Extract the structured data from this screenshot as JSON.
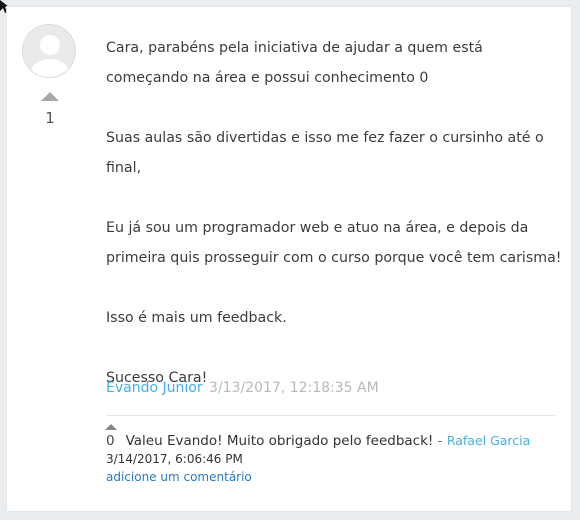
{
  "answer": {
    "score": "1",
    "paragraphs": [
      "Cara, parabéns pela iniciativa de ajudar a quem está começando na área e possui conhecimento 0",
      "Suas aulas são divertidas e isso me fez fazer o cursinho até o final,",
      "Eu já sou um programador web e atuo na área, e depois da primeira quis prosseguir com o curso porque você tem carisma!",
      "Isso é mais um feedback.",
      "Sucesso Cara!"
    ],
    "author": "Evando Junior",
    "date": "3/13/2017, 12:18:35 AM"
  },
  "comment": {
    "score": "0",
    "text": "Valeu Evando! Muito obrigado pelo feedback!",
    "separator": " - ",
    "author": "Rafael Garcia",
    "date": "3/14/2017, 6:06:46 PM"
  },
  "add_comment_label": "adicione um comentário",
  "colors": {
    "link": "#45b0e6",
    "muted": "#b9b9b9",
    "add_link": "#2a7bbd"
  },
  "icons": {
    "avatar": "user-placeholder-icon",
    "upvote": "triangle-up-icon",
    "cursor": "mouse-pointer-icon"
  }
}
